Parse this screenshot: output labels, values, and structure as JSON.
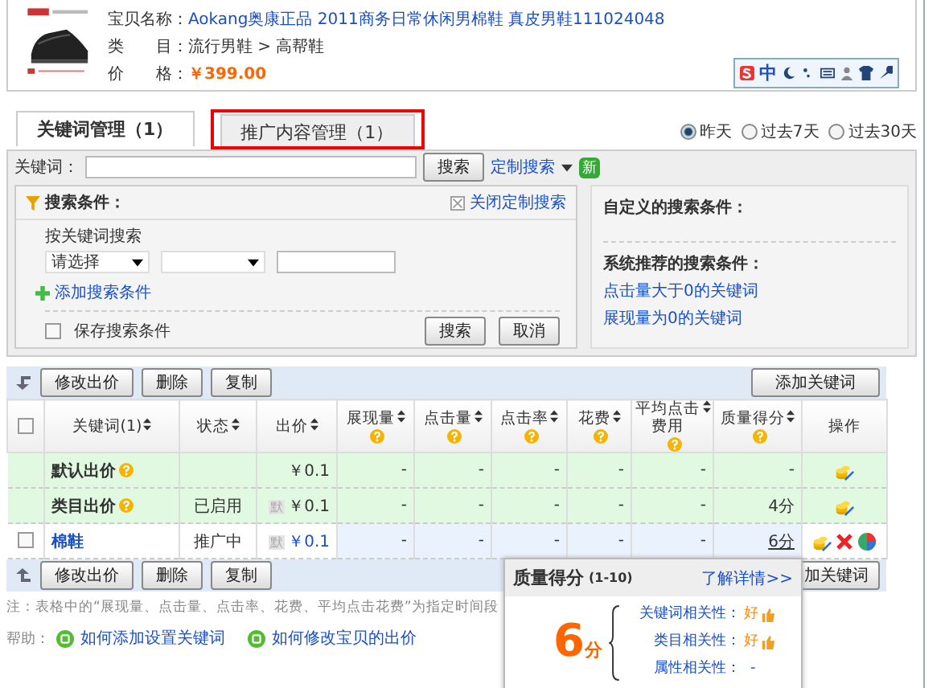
{
  "product": {
    "name_label": "宝贝名称：",
    "name": "Aokang奥康正品 2011商务日常休闲男棉鞋 真皮男鞋111024048",
    "category_label": "类　　目：",
    "category": "流行男鞋 > 高帮鞋",
    "price_label": "价　　格：",
    "price": "￥399.00"
  },
  "ime_toolbar": {
    "mode": "中"
  },
  "tabs": [
    {
      "label": "关键词管理（1）",
      "selected": true,
      "highlighted": false
    },
    {
      "label": "推广内容管理（1）",
      "selected": false,
      "highlighted": true
    }
  ],
  "periods": [
    {
      "label": "昨天",
      "selected": true
    },
    {
      "label": "过去7天",
      "selected": false
    },
    {
      "label": "过去30天",
      "selected": false
    }
  ],
  "search": {
    "label": "关键词：",
    "button": "搜索",
    "custom": "定制搜索",
    "new_badge": "新"
  },
  "conditions": {
    "title": "搜索条件：",
    "close_link": "关闭定制搜索",
    "section": "按关键词搜索",
    "select": "请选择",
    "add_link": "添加搜索条件",
    "save_label": "保存搜索条件",
    "save_checked": false,
    "buttons": [
      "搜索",
      "取消"
    ]
  },
  "custom_panel": {
    "title": "自定义的搜索条件：",
    "recommended_title": "系统推荐的搜索条件：",
    "links": [
      "点击量大于0的关键词",
      "展现量为0的关键词"
    ]
  },
  "toolbar": {
    "buttons": [
      "修改出价",
      "删除",
      "复制"
    ],
    "add": "添加关键词"
  },
  "table": {
    "select_all_checked": false,
    "columns": [
      {
        "label": "关键词(1)",
        "help": false,
        "sortable": true
      },
      {
        "label": "状态",
        "help": false,
        "sortable": true
      },
      {
        "label": "出价",
        "help": false,
        "sortable": true
      },
      {
        "label": "展现量",
        "help": true,
        "sortable": true
      },
      {
        "label": "点击量",
        "help": true,
        "sortable": true
      },
      {
        "label": "点击率",
        "help": true,
        "sortable": true
      },
      {
        "label": "花费",
        "help": true,
        "sortable": true
      },
      {
        "label": "平均点击费用",
        "help": true,
        "sortable": true
      },
      {
        "label": "质量得分",
        "help": true,
        "sortable": true
      },
      {
        "label": "操作",
        "help": false,
        "sortable": false
      }
    ],
    "rows": [
      {
        "kind": "default",
        "default_tag": "",
        "cells": [
          "默认出价",
          "",
          "￥0.1",
          "-",
          "-",
          "-",
          "-",
          "-",
          "-"
        ]
      },
      {
        "kind": "default",
        "default_tag": "默",
        "cells": [
          "类目出价",
          "已启用",
          "￥0.1",
          "-",
          "-",
          "-",
          "-",
          "-",
          "4分"
        ]
      },
      {
        "kind": "keyword",
        "checked": false,
        "default_tag": "默",
        "cells": [
          "棉鞋",
          "推广中",
          "￥0.1",
          "-",
          "-",
          "-",
          "-",
          "-",
          "6分"
        ]
      }
    ]
  },
  "bottom_toolbar": {
    "buttons": [
      "修改出价",
      "删除",
      "复制"
    ],
    "add": "加关键词"
  },
  "note": "注：表格中的“展现量、点击量、点击率、花费、平均点击花费”为指定时间段",
  "help": {
    "label": "帮助：",
    "links": [
      "如何添加设置关键词",
      "如何修改宝贝的出价"
    ]
  },
  "popup": {
    "title": "质量得分",
    "range": "(1-10)",
    "more": "了解详情>>",
    "score": "6",
    "unit": "分",
    "items": [
      {
        "label": "关键词相关性：",
        "value": "好",
        "thumb": true
      },
      {
        "label": "类目相关性：",
        "value": "好",
        "thumb": true
      },
      {
        "label": "属性相关性：",
        "value": "-",
        "thumb": false
      }
    ]
  }
}
